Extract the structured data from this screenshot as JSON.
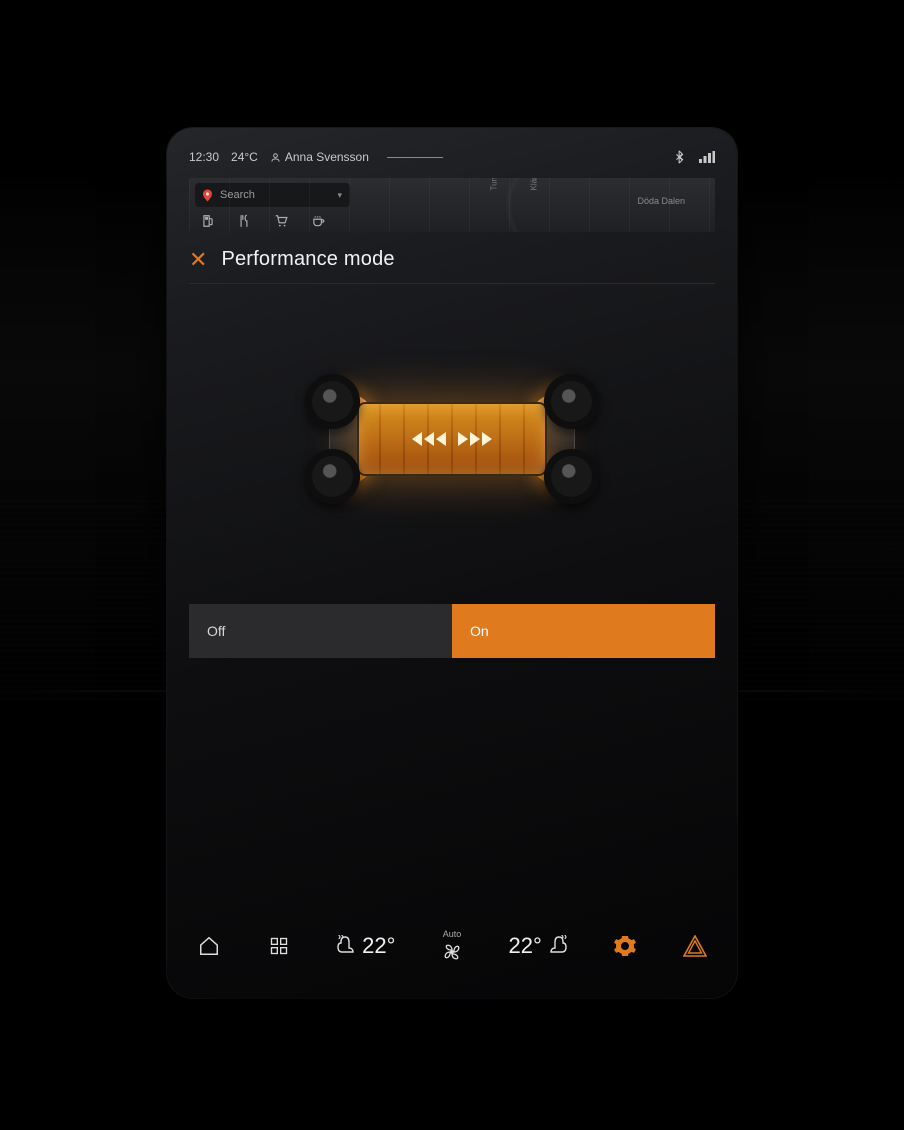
{
  "statusbar": {
    "time": "12:30",
    "temp_outside": "24°C",
    "profile_name": "Anna Svensson"
  },
  "map": {
    "search_placeholder": "Search",
    "area_label": "Döda Dalen",
    "road1": "Tunnelvägen",
    "road2": "Klämlvägen"
  },
  "page": {
    "title": "Performance mode"
  },
  "toggle": {
    "off_label": "Off",
    "on_label": "On",
    "selected": "on"
  },
  "climate": {
    "left_temp": "22°",
    "right_temp": "22°",
    "fan_mode": "Auto"
  },
  "colors": {
    "accent": "#e07a1f"
  }
}
